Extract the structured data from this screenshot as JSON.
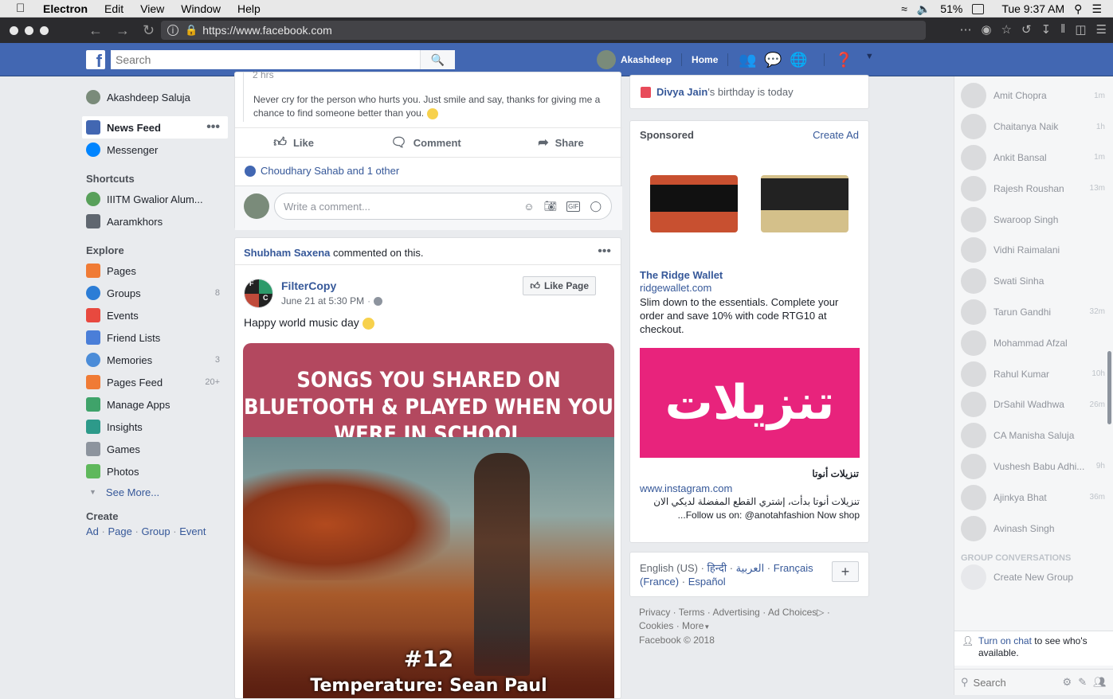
{
  "mac": {
    "app": "Electron",
    "menus": [
      "Edit",
      "View",
      "Window",
      "Help"
    ],
    "battery": "51%",
    "clock": "Tue 9:37 AM"
  },
  "browser": {
    "url": "https://www.facebook.com"
  },
  "fb": {
    "search_placeholder": "Search",
    "user": "Akashdeep",
    "home": "Home"
  },
  "left": {
    "profile": "Akashdeep Saluja",
    "items": [
      {
        "label": "News Feed",
        "count": ""
      },
      {
        "label": "Messenger",
        "count": ""
      }
    ],
    "shortcuts_title": "Shortcuts",
    "shortcuts": [
      "IIITM Gwalior Alum...",
      "Aaramkhors"
    ],
    "explore_title": "Explore",
    "explore": [
      {
        "label": "Pages",
        "count": ""
      },
      {
        "label": "Groups",
        "count": "8"
      },
      {
        "label": "Events",
        "count": ""
      },
      {
        "label": "Friend Lists",
        "count": ""
      },
      {
        "label": "Memories",
        "count": "3"
      },
      {
        "label": "Pages Feed",
        "count": "20+"
      },
      {
        "label": "Manage Apps",
        "count": ""
      },
      {
        "label": "Insights",
        "count": ""
      },
      {
        "label": "Games",
        "count": ""
      },
      {
        "label": "Photos",
        "count": ""
      }
    ],
    "see_more": "See More...",
    "create_title": "Create",
    "create_links": [
      "Ad",
      "Page",
      "Group",
      "Event"
    ]
  },
  "post1": {
    "time": "2 hrs",
    "text": "Never cry for the person who hurts you. Just smile and say, thanks for giving me a chance to find someone better than you.",
    "like": "Like",
    "comment": "Comment",
    "share": "Share",
    "reactions": "Choudhary Sahab and 1 other",
    "comment_placeholder": "Write a comment..."
  },
  "post2": {
    "commenter": "Shubham Saxena",
    "commented": "commented on this.",
    "page": "FilterCopy",
    "time": "June 21 at 5:30 PM",
    "like_page": "Like Page",
    "text": "Happy world music day",
    "image_title": "SONGS YOU SHARED ON BLUETOOTH & PLAYED WHEN YOU WERE IN SCHOOL",
    "image_number": "#12",
    "image_song": "Temperature: Sean Paul"
  },
  "right": {
    "birthday_name": "Divya Jain",
    "birthday_text": "'s birthday is today",
    "sponsored": "Sponsored",
    "create_ad": "Create Ad",
    "ad1_title": "The Ridge Wallet",
    "ad1_url": "ridgewallet.com",
    "ad1_text": "Slim down to the essentials. Complete your order and save 10% with code RTG10 at checkout.",
    "ad2_banner": "تنزيلات",
    "ad2_title": "تنزيلات أنوتا",
    "ad2_url": "www.instagram.com",
    "ad2_text": "تنزيلات أنوتا بدأت، إشتري القطع المفضلة لديكي الان Follow us on: @anotahfashion Now shop...",
    "languages": [
      "English (US)",
      "हिन्दी",
      "العربية",
      "Français (France)",
      "Español"
    ],
    "footer_links": [
      "Privacy",
      "Terms",
      "Advertising",
      "Ad Choices",
      "Cookies",
      "More"
    ],
    "copyright": "Facebook © 2018"
  },
  "chat": {
    "contacts": [
      {
        "name": "Amit Chopra",
        "time": "1m"
      },
      {
        "name": "Chaitanya Naik",
        "time": "1h"
      },
      {
        "name": "Ankit Bansal",
        "time": "1m"
      },
      {
        "name": "Rajesh Roushan",
        "time": "13m"
      },
      {
        "name": "Swaroop Singh",
        "time": ""
      },
      {
        "name": "Vidhi Raimalani",
        "time": ""
      },
      {
        "name": "Swati Sinha",
        "time": ""
      },
      {
        "name": "Tarun Gandhi",
        "time": "32m"
      },
      {
        "name": "Mohammad Afzal",
        "time": ""
      },
      {
        "name": "Rahul Kumar",
        "time": "10h"
      },
      {
        "name": "DrSahil Wadhwa",
        "time": "26m"
      },
      {
        "name": "CA Manisha Saluja",
        "time": ""
      },
      {
        "name": "Vushesh Babu Adhi...",
        "time": "9h"
      },
      {
        "name": "Ajinkya Bhat",
        "time": "36m"
      },
      {
        "name": "Avinash Singh",
        "time": ""
      }
    ],
    "group_title": "GROUP CONVERSATIONS",
    "create_group": "Create New Group",
    "turn_on": "Turn on chat",
    "turn_on_rest": "to see who's available.",
    "search_placeholder": "Search"
  }
}
